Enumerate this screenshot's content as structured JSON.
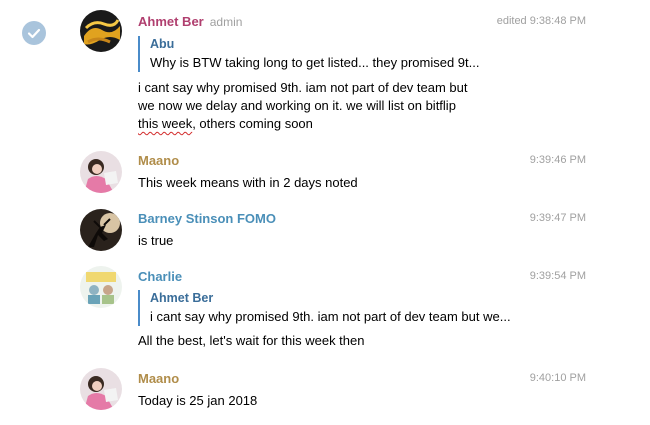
{
  "messages": [
    {
      "author": "Ahmet Ber",
      "role": "admin",
      "time": "edited 9:38:48 PM",
      "author_color": "#b03f6f",
      "reply": {
        "author": "Abu",
        "text": "Why is BTW taking long to get listed... they promised 9t..."
      },
      "lines": [
        "i cant say why promised 9th. iam not part of dev team but",
        "we now we delay and working on it. we will list on bitflip"
      ],
      "last_line_marked": "this week",
      "last_line_rest": ", others coming soon"
    },
    {
      "author": "Maano",
      "time": "9:39:46 PM",
      "author_color": "#b08d4a",
      "text": "This week means with in 2 days noted"
    },
    {
      "author": "Barney Stinson FOMO",
      "time": "9:39:47 PM",
      "author_color": "#4a8fb8",
      "text": "is true"
    },
    {
      "author": "Charlie",
      "time": "9:39:54 PM",
      "author_color": "#4a8fb8",
      "reply": {
        "author": "Ahmet Ber",
        "text": "i cant say why promised 9th. iam not part of dev team but we..."
      },
      "text": "All the best, let's wait for this week then"
    },
    {
      "author": "Maano",
      "time": "9:40:10 PM",
      "author_color": "#b08d4a",
      "text": "Today is 25 jan 2018"
    }
  ],
  "icons": {
    "selected": "check-icon"
  }
}
